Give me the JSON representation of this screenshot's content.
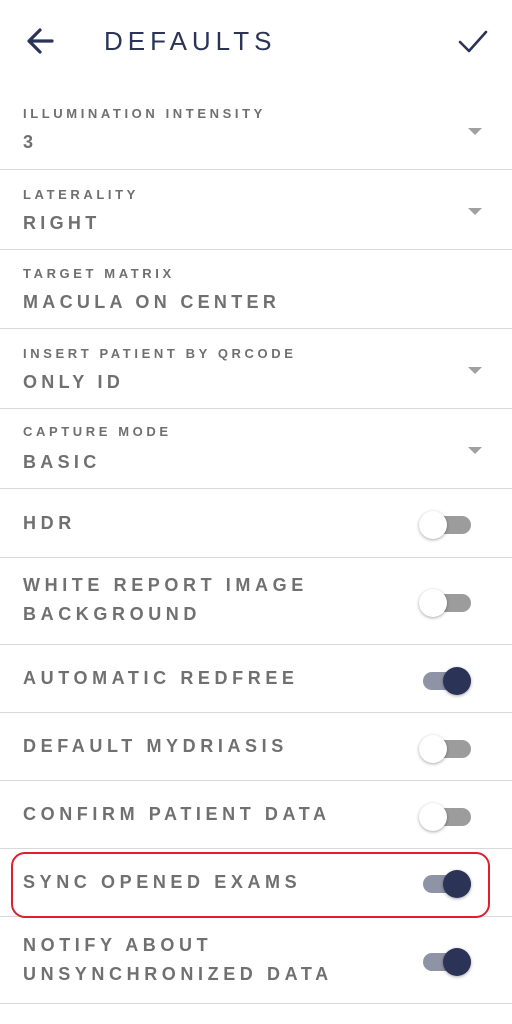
{
  "header": {
    "title": "DEFAULTS",
    "back_icon": "arrow-left-icon",
    "confirm_icon": "check-icon",
    "color": "#2b3457"
  },
  "selects": [
    {
      "label": "ILLUMINATION INTENSITY",
      "value": "3",
      "has_dropdown": true
    },
    {
      "label": "LATERALITY",
      "value": "RIGHT",
      "has_dropdown": true
    },
    {
      "label": "TARGET MATRIX",
      "value": "MACULA ON CENTER",
      "has_dropdown": false
    },
    {
      "label": "INSERT PATIENT BY QRCODE",
      "value": "ONLY ID",
      "has_dropdown": true
    },
    {
      "label": "CAPTURE MODE",
      "value": "BASIC",
      "has_dropdown": true
    }
  ],
  "toggles": [
    {
      "label_lines": [
        "HDR"
      ],
      "on": false
    },
    {
      "label_lines": [
        "WHITE REPORT IMAGE",
        "BACKGROUND"
      ],
      "on": false
    },
    {
      "label_lines": [
        "AUTOMATIC REDFREE"
      ],
      "on": true
    },
    {
      "label_lines": [
        "DEFAULT MYDRIASIS"
      ],
      "on": false
    },
    {
      "label_lines": [
        "CONFIRM PATIENT DATA"
      ],
      "on": false
    },
    {
      "label_lines": [
        "SYNC OPENED EXAMS"
      ],
      "on": true,
      "highlighted": true
    },
    {
      "label_lines": [
        "NOTIFY ABOUT",
        "UNSYNCHRONIZED DATA"
      ],
      "on": true
    }
  ],
  "colors": {
    "accent": "#2b3457",
    "highlight": "#e01e2d",
    "text": "#707070",
    "divider": "#d9d9d9"
  }
}
